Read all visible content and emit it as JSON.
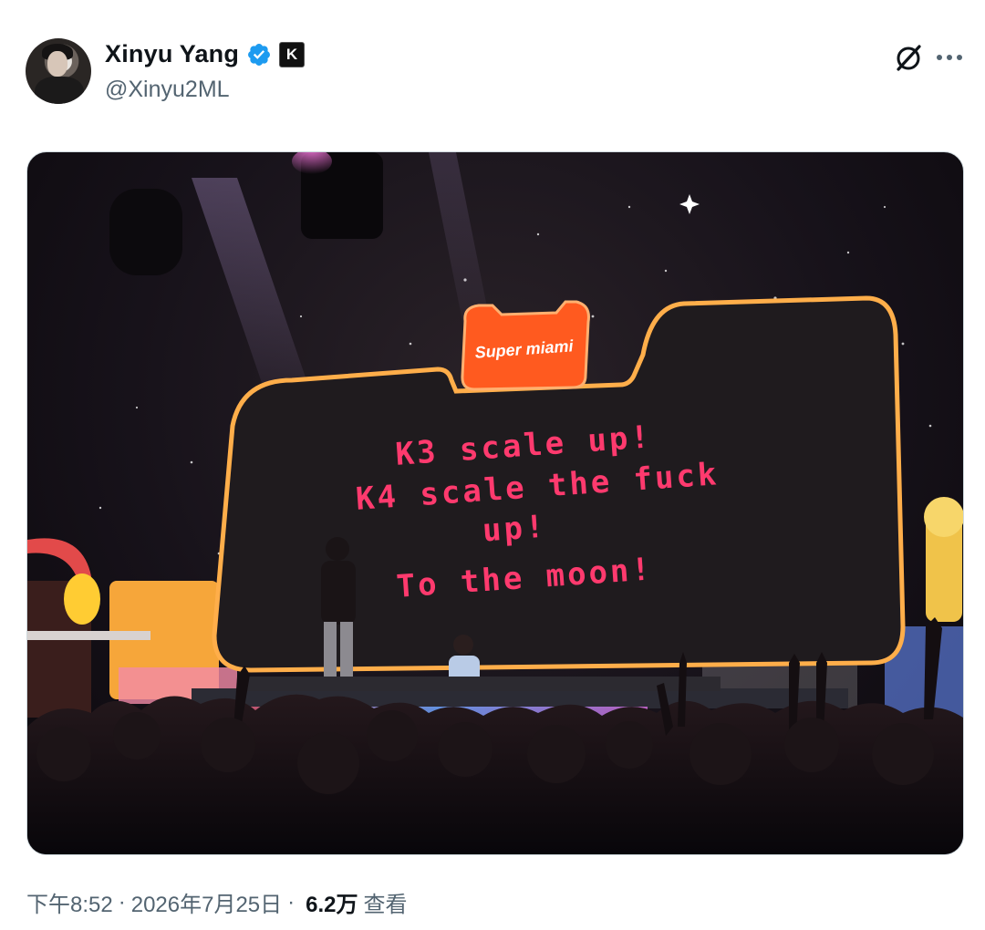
{
  "author": {
    "display_name": "Xinyu Yang",
    "handle": "@Xinyu2ML",
    "verified_color": "#1d9bf0",
    "affiliate_badge": "K"
  },
  "media": {
    "screen_logo": "Super miami",
    "screen_lines": [
      "K3 scale up!",
      "K4 scale the fuck",
      "up!",
      "To the moon!"
    ],
    "screen_text_color": "#ff3a6e",
    "frame_color": "#ffb347"
  },
  "meta": {
    "time": "下午8:52",
    "separator": "·",
    "date": "2026年7月25日",
    "views_count": "6.2万",
    "views_label": "查看"
  },
  "icons": {
    "grok": "grok-icon",
    "more": "more-icon",
    "verified": "verified-badge-icon"
  }
}
